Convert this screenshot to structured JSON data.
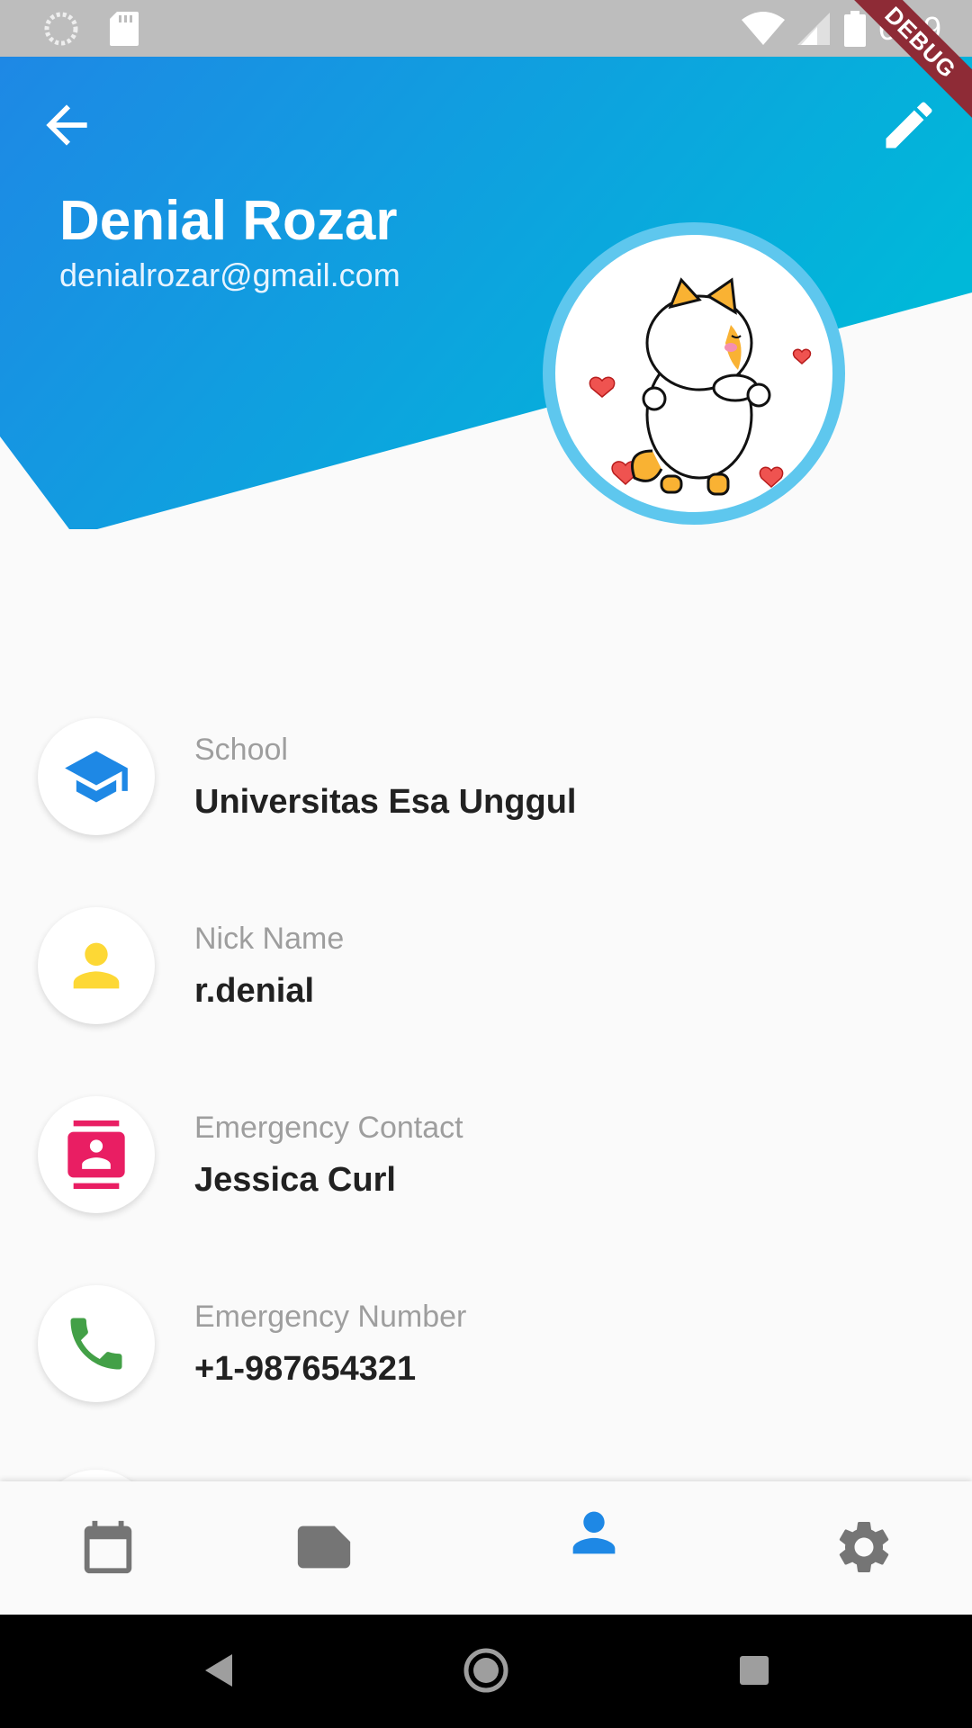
{
  "status_bar": {
    "time": "6:49",
    "icons": [
      "sync-icon",
      "sd-card-icon",
      "wifi-icon",
      "cell-signal-icon",
      "battery-icon"
    ]
  },
  "debug_banner": "DEBUG",
  "header": {
    "name": "Denial Rozar",
    "email": "denialrozar@gmail.com",
    "gradient_start": "#1e88e5",
    "gradient_end": "#00b8d9"
  },
  "info_items": [
    {
      "label": "School",
      "value": "Universitas Esa Unggul",
      "icon": "school-icon",
      "color": "#1e88e5"
    },
    {
      "label": "Nick Name",
      "value": "r.denial",
      "icon": "person-icon",
      "color": "#fdd835"
    },
    {
      "label": "Emergency Contact",
      "value": "Jessica Curl",
      "icon": "contact-card-icon",
      "color": "#e91e63"
    },
    {
      "label": "Emergency Number",
      "value": "+1-987654321",
      "icon": "phone-icon",
      "color": "#43a047"
    }
  ],
  "bottom_nav": {
    "items": [
      {
        "icon": "calendar-icon",
        "active": false
      },
      {
        "icon": "note-icon",
        "active": false
      },
      {
        "icon": "person-icon",
        "active": true
      },
      {
        "icon": "settings-icon",
        "active": false
      }
    ],
    "active_color": "#1e88e5",
    "inactive_color": "#757575"
  },
  "system_nav": [
    "back-triangle-icon",
    "home-circle-icon",
    "recents-square-icon"
  ]
}
